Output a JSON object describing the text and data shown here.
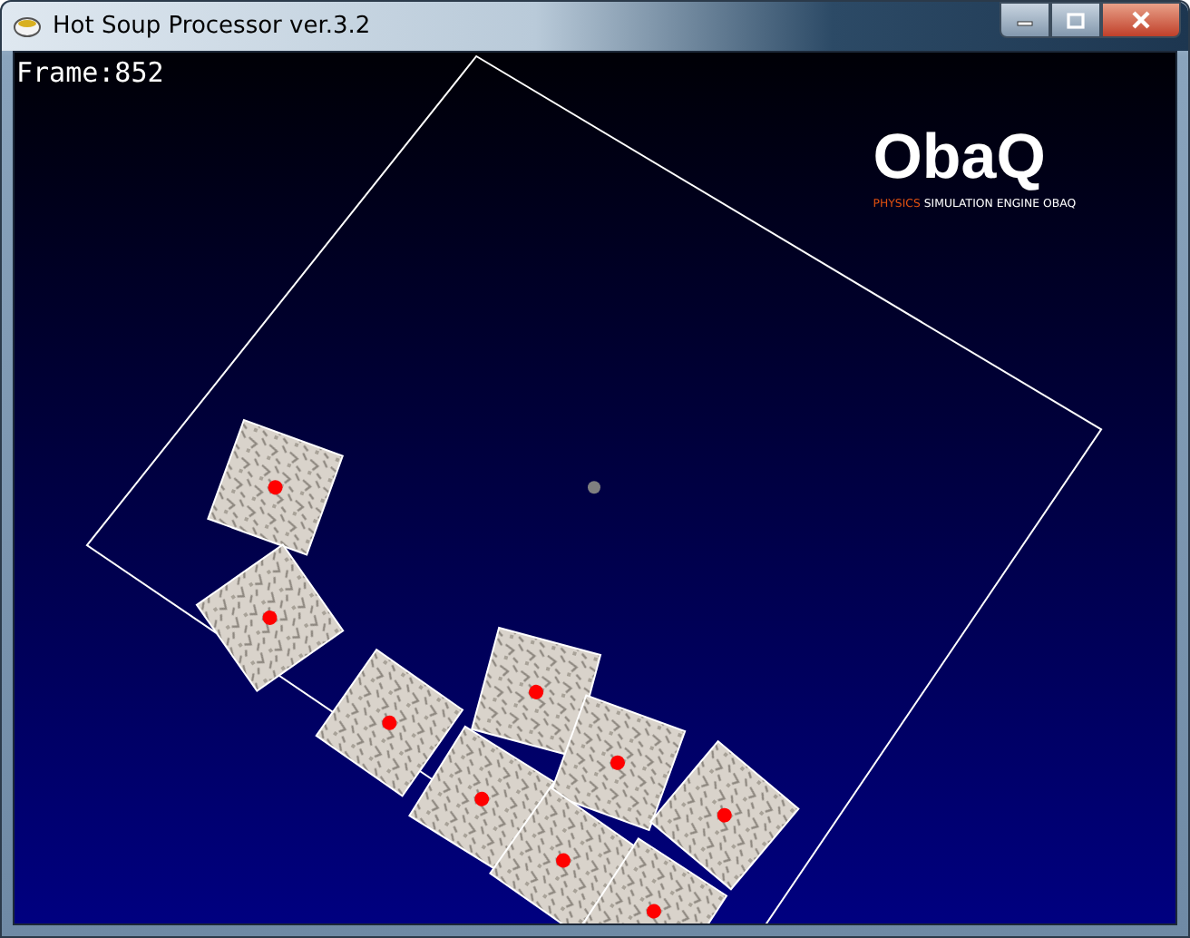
{
  "window": {
    "title": "Hot Soup Processor ver.3.2"
  },
  "canvas": {
    "frame_label": "Frame:852"
  },
  "logo": {
    "wordmark": "ObaQ",
    "tagline_highlight": "PHYSICS",
    "tagline": "SIMULATION ENGINE OBAQ"
  }
}
